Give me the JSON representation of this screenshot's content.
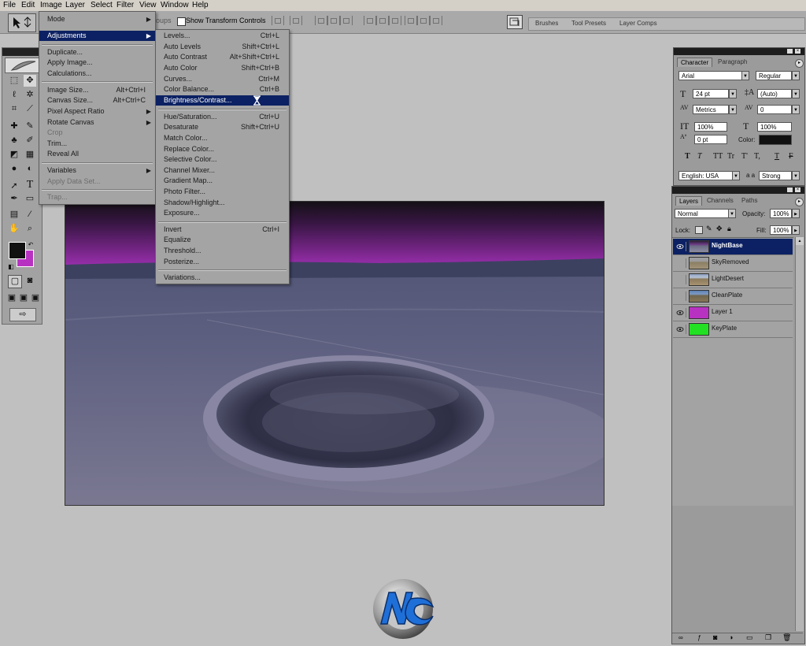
{
  "menubar": {
    "items": [
      "File",
      "Edit",
      "Image",
      "Layer",
      "Select",
      "Filter",
      "View",
      "Window",
      "Help"
    ]
  },
  "options_bar": {
    "groups_partial": "oups",
    "show_transform_label": "Show Transform Controls",
    "well_tabs": [
      "Brushes",
      "Tool Presets",
      "Layer Comps"
    ]
  },
  "image_menu": {
    "items": [
      {
        "label": "Mode",
        "submenu": true
      },
      {
        "label": "Adjustments",
        "submenu": true,
        "highlight": true
      },
      {
        "sep": true
      },
      {
        "label": "Duplicate..."
      },
      {
        "label": "Apply Image..."
      },
      {
        "label": "Calculations..."
      },
      {
        "sep": true
      },
      {
        "label": "Image Size...",
        "shortcut": "Alt+Ctrl+I"
      },
      {
        "label": "Canvas Size...",
        "shortcut": "Alt+Ctrl+C"
      },
      {
        "label": "Pixel Aspect Ratio",
        "submenu": true
      },
      {
        "label": "Rotate Canvas",
        "submenu": true
      },
      {
        "label": "Crop",
        "disabled": true
      },
      {
        "label": "Trim..."
      },
      {
        "label": "Reveal All"
      },
      {
        "sep": true
      },
      {
        "label": "Variables",
        "submenu": true
      },
      {
        "label": "Apply Data Set...",
        "disabled": true
      },
      {
        "sep": true
      },
      {
        "label": "Trap...",
        "disabled": true
      }
    ]
  },
  "adjustments_menu": {
    "items": [
      {
        "label": "Levels...",
        "shortcut": "Ctrl+L"
      },
      {
        "label": "Auto Levels",
        "shortcut": "Shift+Ctrl+L"
      },
      {
        "label": "Auto Contrast",
        "shortcut": "Alt+Shift+Ctrl+L"
      },
      {
        "label": "Auto Color",
        "shortcut": "Shift+Ctrl+B"
      },
      {
        "label": "Curves...",
        "shortcut": "Ctrl+M"
      },
      {
        "label": "Color Balance...",
        "shortcut": "Ctrl+B"
      },
      {
        "label": "Brightness/Contrast...",
        "highlight": true
      },
      {
        "sep": true
      },
      {
        "label": "Hue/Saturation...",
        "shortcut": "Ctrl+U"
      },
      {
        "label": "Desaturate",
        "shortcut": "Shift+Ctrl+U"
      },
      {
        "label": "Match Color..."
      },
      {
        "label": "Replace Color..."
      },
      {
        "label": "Selective Color..."
      },
      {
        "label": "Channel Mixer..."
      },
      {
        "label": "Gradient Map..."
      },
      {
        "label": "Photo Filter..."
      },
      {
        "label": "Shadow/Highlight..."
      },
      {
        "label": "Exposure..."
      },
      {
        "sep": true
      },
      {
        "label": "Invert",
        "shortcut": "Ctrl+I"
      },
      {
        "label": "Equalize"
      },
      {
        "label": "Threshold..."
      },
      {
        "label": "Posterize..."
      },
      {
        "sep": true
      },
      {
        "label": "Variations..."
      }
    ]
  },
  "character_panel": {
    "tabs": [
      "Character",
      "Paragraph"
    ],
    "font_family": "Arial",
    "font_style": "Regular",
    "font_size": "24 pt",
    "leading": "(Auto)",
    "kerning": "Metrics",
    "tracking": "0",
    "vertical_scale": "100%",
    "horizontal_scale": "100%",
    "baseline_shift": "0 pt",
    "color_label": "Color:",
    "language": "English: USA",
    "antialias": "Strong",
    "aa_label": "a a",
    "style_buttons": [
      "T",
      "T",
      "TT",
      "Tr",
      "T'",
      "T,",
      "T",
      "F"
    ]
  },
  "layers_panel": {
    "tabs": [
      "Layers",
      "Channels",
      "Paths"
    ],
    "blend_mode": "Normal",
    "opacity_label": "Opacity:",
    "opacity": "100%",
    "lock_label": "Lock:",
    "fill_label": "Fill:",
    "fill": "100%",
    "layers": [
      {
        "name": "NightBase",
        "visible": true,
        "selected": true,
        "thumb": "photo"
      },
      {
        "name": "SkyRemoved",
        "visible": false,
        "selected": false,
        "thumb": "photo"
      },
      {
        "name": "LightDesert",
        "visible": false,
        "selected": false,
        "thumb": "photo"
      },
      {
        "name": "CleanPlate",
        "visible": false,
        "selected": false,
        "thumb": "photo"
      },
      {
        "name": "Layer 1",
        "visible": true,
        "selected": false,
        "thumb": "#b832c2"
      },
      {
        "name": "KeyPlate",
        "visible": true,
        "selected": false,
        "thumb": "#22e022"
      }
    ]
  },
  "colors": {
    "foreground": "#111111",
    "background": "#b832c2",
    "menu_highlight": "#0c2163",
    "sky_purple": "#9a2fae"
  }
}
